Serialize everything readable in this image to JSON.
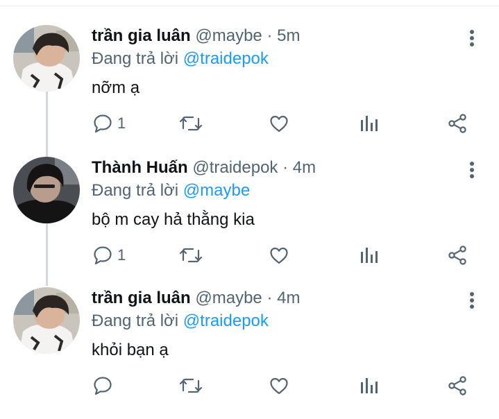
{
  "colors": {
    "name": "#0f1419",
    "secondary": "#536471",
    "mention": "#1d9bf0",
    "thread_line": "#cfd9de"
  },
  "tweets": [
    {
      "name": "trần gia luân",
      "handle": "@maybe",
      "separator": "·",
      "time": "5m",
      "reply_prefix": "Đang trả lời",
      "reply_to": "@traidepok",
      "text": "nỡm ạ",
      "reply_count": "1",
      "avatar": "avatar-photo-gia-luan",
      "icons": [
        "reply-icon",
        "retweet-icon",
        "like-icon",
        "analytics-icon",
        "share-icon",
        "more-options-icon"
      ]
    },
    {
      "name": "Thành Huấn",
      "handle": "@traidepok",
      "separator": "·",
      "time": "4m",
      "reply_prefix": "Đang trả lời",
      "reply_to": "@maybe",
      "text": "bộ m cay hả thằng kia",
      "reply_count": "1",
      "avatar": "avatar-photo-thanh-huan",
      "icons": [
        "reply-icon",
        "retweet-icon",
        "like-icon",
        "analytics-icon",
        "share-icon",
        "more-options-icon"
      ]
    },
    {
      "name": "trần gia luân",
      "handle": "@maybe",
      "separator": "·",
      "time": "4m",
      "reply_prefix": "Đang trả lời",
      "reply_to": "@traidepok",
      "text": "khỏi bạn ạ",
      "reply_count": "",
      "avatar": "avatar-photo-gia-luan",
      "icons": [
        "reply-icon",
        "retweet-icon",
        "like-icon",
        "analytics-icon",
        "share-icon",
        "more-options-icon"
      ]
    }
  ]
}
